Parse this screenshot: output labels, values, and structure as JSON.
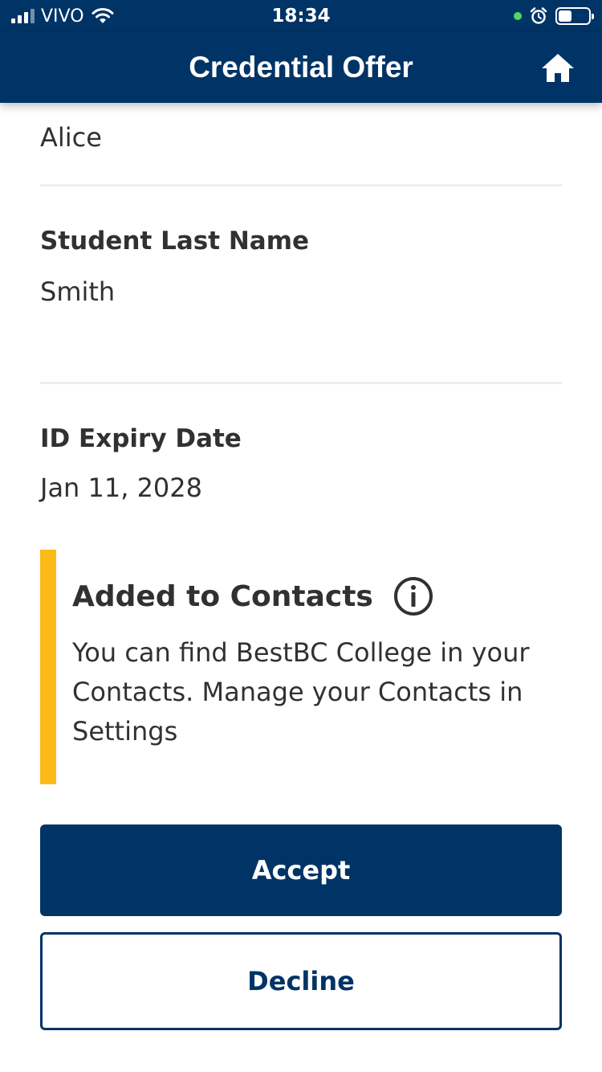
{
  "status_bar": {
    "carrier": "VIVO",
    "time": "18:34",
    "battery_level": 0.45
  },
  "header": {
    "title": "Credential Offer",
    "home_icon": "home-icon"
  },
  "attributes": [
    {
      "label": "",
      "value": "Alice"
    },
    {
      "label": "Student Last Name",
      "value": "Smith"
    },
    {
      "label": "ID Expiry Date",
      "value": "Jan 11, 2028"
    }
  ],
  "notice": {
    "title": "Added to Contacts",
    "icon": "info-icon",
    "body": "You can find BestBC College in your Contacts. Manage your Contacts in Settings",
    "accent_color": "#fcba19"
  },
  "actions": {
    "accept_label": "Accept",
    "decline_label": "Decline"
  },
  "colors": {
    "primary": "#003366",
    "text": "#313132"
  }
}
